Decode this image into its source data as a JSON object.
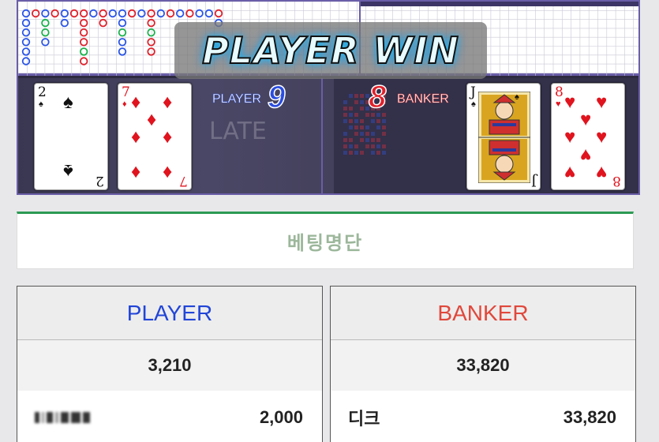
{
  "game": {
    "banner_text": "PLAYER WIN",
    "plate_text": "LATE",
    "player": {
      "label": "PLAYER",
      "score": "9",
      "cards": [
        {
          "rank": "2",
          "suit": "♠",
          "color": "black"
        },
        {
          "rank": "7",
          "suit": "♦",
          "color": "red"
        }
      ]
    },
    "banker": {
      "label": "BANKER",
      "score": "8",
      "cards": [
        {
          "rank": "J",
          "suit": "♠",
          "color": "black"
        },
        {
          "rank": "8",
          "suit": "♥",
          "color": "red"
        }
      ]
    }
  },
  "betting_list": {
    "title": "베팅명단",
    "player": {
      "header": "PLAYER",
      "total": "3,210",
      "rows": [
        {
          "name": "",
          "amount": "2,000"
        }
      ]
    },
    "banker": {
      "header": "BANKER",
      "total": "33,820",
      "rows": [
        {
          "name": "디크",
          "amount": "33,820"
        }
      ]
    }
  },
  "colors": {
    "player_blue": "#2145d8",
    "banker_red": "#e0483c",
    "accent_green": "#2b9a53"
  }
}
